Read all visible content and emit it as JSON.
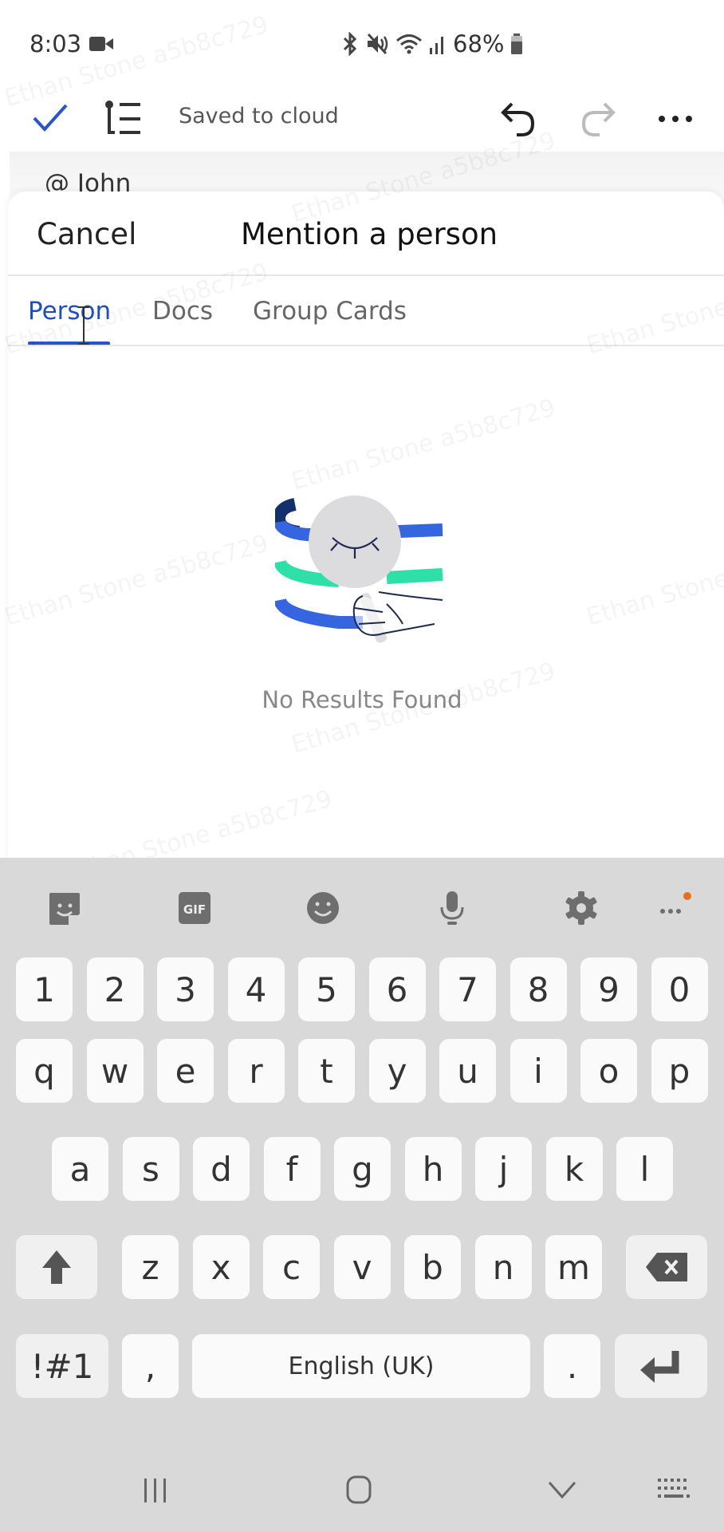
{
  "status_bar": {
    "time": "8:03",
    "battery": "68%",
    "icons": [
      "video-recording-icon",
      "bluetooth-icon",
      "mute-icon",
      "wifi-icon",
      "signal-icon",
      "battery-icon"
    ]
  },
  "toolbar": {
    "saved_status": "Saved to cloud",
    "icons": [
      "check-icon",
      "outline-icon",
      "undo-icon",
      "redo-icon",
      "more-icon"
    ]
  },
  "document": {
    "mention_text": "@ John"
  },
  "sheet": {
    "cancel_label": "Cancel",
    "title": "Mention a person",
    "tabs": [
      {
        "label": "Person",
        "active": true
      },
      {
        "label": "Docs",
        "active": false
      },
      {
        "label": "Group Cards",
        "active": false
      }
    ],
    "empty_state": "No Results Found",
    "accent_color": "#2a55c9"
  },
  "watermark": "Ethan Stone a5b8c729",
  "keyboard": {
    "toolbar": [
      "sticker-icon",
      "gif-icon",
      "emoji-icon",
      "microphone-icon",
      "settings-icon",
      "more-icon"
    ],
    "gif_label": "GIF",
    "rows": [
      [
        "1",
        "2",
        "3",
        "4",
        "5",
        "6",
        "7",
        "8",
        "9",
        "0"
      ],
      [
        "q",
        "w",
        "e",
        "r",
        "t",
        "y",
        "u",
        "i",
        "o",
        "p"
      ],
      [
        "a",
        "s",
        "d",
        "f",
        "g",
        "h",
        "j",
        "k",
        "l"
      ],
      [
        "z",
        "x",
        "c",
        "v",
        "b",
        "n",
        "m"
      ]
    ],
    "symbols_label": "!#1",
    "comma_label": ",",
    "space_label": "English (UK)",
    "period_label": "."
  },
  "nav_bar": [
    "recent-apps-icon",
    "home-icon",
    "hide-keyboard-icon",
    "keyboard-switch-icon"
  ]
}
